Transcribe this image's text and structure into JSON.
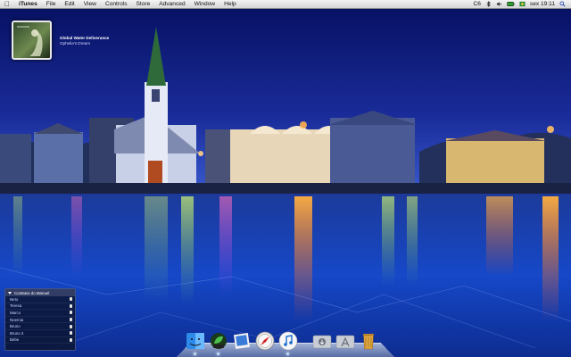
{
  "menubar": {
    "app_name": "iTunes",
    "menus": [
      "File",
      "Edit",
      "View",
      "Controls",
      "Store",
      "Advanced",
      "Window",
      "Help"
    ],
    "status_number": "C6",
    "clock": "sex 19:11",
    "tray_icons": [
      "bluetooth-icon",
      "volume-icon",
      "battery-icon",
      "flag-icon",
      "spotlight-icon"
    ]
  },
  "now_playing": {
    "title": "Global Water Deliverance",
    "artist": "Ophelia's Dream"
  },
  "contacts_widget": {
    "title": "Contatos do Manuel",
    "contacts": [
      "Neto",
      "Teresa",
      "Marco",
      "Noemia",
      "Bruno",
      "Bruno 2",
      "Bebe"
    ]
  },
  "dock": {
    "items": [
      {
        "icon": "finder-icon",
        "running": true
      },
      {
        "icon": "leaf-app-icon",
        "running": true
      },
      {
        "icon": "preview-icon",
        "running": false
      },
      {
        "icon": "safari-compass-icon",
        "running": false
      },
      {
        "icon": "itunes-icon",
        "running": true
      },
      {
        "icon": "downloads-folder-icon",
        "running": false
      },
      {
        "icon": "applications-folder-icon",
        "running": false
      },
      {
        "icon": "trash-icon",
        "running": false
      }
    ]
  },
  "colors": {
    "sky_top": "#0a1a8a",
    "sky_bottom": "#3050c8",
    "ice": "#1640b0",
    "reflection_warm": "#ff7a20",
    "reflection_green": "#c8ff50"
  }
}
